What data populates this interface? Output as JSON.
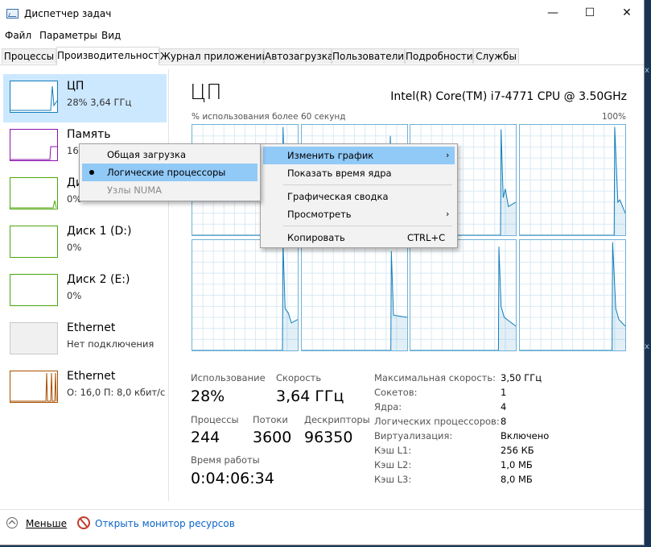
{
  "window": {
    "title": "Диспетчер задач",
    "controls": {
      "minimize": "—",
      "maximize": "☐",
      "close": "✕"
    }
  },
  "menu": [
    "Файл",
    "Параметры",
    "Вид"
  ],
  "tabs": [
    "Процессы",
    "Производительность",
    "Журнал приложений",
    "Автозагрузка",
    "Пользователи",
    "Подробности",
    "Службы"
  ],
  "active_tab": "Производительность",
  "sidebar": {
    "items": [
      {
        "name": "ЦП",
        "sub": "28% 3,64 ГГц",
        "color": "#117dbb",
        "selected": true
      },
      {
        "name": "Память",
        "sub": "16",
        "color": "#8b12ae"
      },
      {
        "name": "Ди",
        "sub": "0%",
        "color": "#4da60c"
      },
      {
        "name": "Диск 1 (D:)",
        "sub": "0%",
        "color": "#4da60c"
      },
      {
        "name": "Диск 2 (E:)",
        "sub": "0%",
        "color": "#4da60c"
      },
      {
        "name": "Ethernet",
        "sub": "Нет подключения",
        "color": "#aaaaaa"
      },
      {
        "name": "Ethernet",
        "sub": "О: 16,0  П: 8,0 кбит/с",
        "color": "#a74f01"
      }
    ]
  },
  "main": {
    "title": "ЦП",
    "cpu_name": "Intel(R) Core(TM) i7-4771 CPU @ 3.50GHz",
    "graph_label": "% использования более 60 секунд",
    "graph_max": "100%",
    "graph_color": "#117dbb",
    "grid_color": "#d9eaf4"
  },
  "stats": {
    "usage_label": "Использование",
    "usage": "28%",
    "speed_label": "Скорость",
    "speed": "3,64 ГГц",
    "processes_label": "Процессы",
    "processes": "244",
    "threads_label": "Потоки",
    "threads": "3600",
    "handles_label": "Дескрипторы",
    "handles": "96350",
    "uptime_label": "Время работы",
    "uptime": "0:04:06:34"
  },
  "specs": [
    {
      "label": "Максимальная скорость:",
      "value": "3,50 ГГц"
    },
    {
      "label": "Сокетов:",
      "value": "1"
    },
    {
      "label": "Ядра:",
      "value": "4"
    },
    {
      "label": "Логических процессоров:",
      "value": "8"
    },
    {
      "label": "Виртуализация:",
      "value": "Включено"
    },
    {
      "label": "Кэш L1:",
      "value": "256 КБ"
    },
    {
      "label": "Кэш L2:",
      "value": "1,0 МБ"
    },
    {
      "label": "Кэш L3:",
      "value": "8,0 МБ"
    }
  ],
  "footer": {
    "less": "Меньше",
    "monitor": "Открыть монитор ресурсов"
  },
  "context_menu": {
    "items": [
      {
        "label": "Изменить график",
        "submenu": true
      },
      {
        "label": "Показать время ядра"
      },
      {
        "label": "Графическая сводка"
      },
      {
        "label": "Просмотреть",
        "submenu": true
      },
      {
        "label": "Копировать",
        "shortcut": "CTRL+C"
      }
    ],
    "submenu_arrow": "›"
  },
  "submenu": {
    "items": [
      {
        "label": "Общая загрузка"
      },
      {
        "label": "Логические процессоры",
        "checked": true
      },
      {
        "label": "Узлы NUMA",
        "disabled": true
      }
    ]
  },
  "edge_glyphs": [
    "x",
    "x"
  ]
}
